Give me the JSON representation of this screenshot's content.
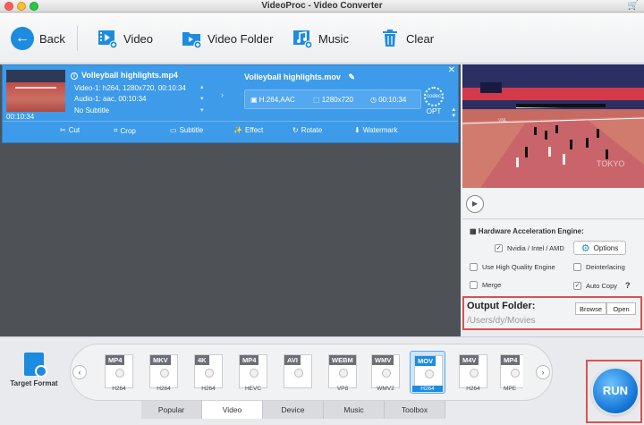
{
  "window": {
    "title": "VideoProc - Video Converter"
  },
  "toolbar": {
    "back": "Back",
    "video": "Video",
    "video_folder": "Video Folder",
    "music": "Music",
    "clear": "Clear"
  },
  "task": {
    "thumb_time": "00:10:34",
    "source_name": "Volleyball highlights.mp4",
    "video_track": "Video-1: h264, 1280x720, 00:10:34",
    "audio_track": "Audio-1: aac, 00:10:34",
    "subtitle": "No Subtitle",
    "output_name": "Volleyball highlights.mov",
    "codec": "H.264,AAC",
    "resolution": "1280x720",
    "duration": "00:10:34",
    "opt_label": "OPT",
    "codec_label": "codec",
    "edits": [
      "Cut",
      "Crop",
      "Subtitle",
      "Effect",
      "Rotate",
      "Watermark"
    ]
  },
  "hardware": {
    "title": "Hardware Acceleration Engine:",
    "nvidia": "Nvidia / Intel / AMD",
    "options": "Options",
    "high_quality": "Use High Quality Engine",
    "deinterlacing": "Deinterlacing",
    "merge": "Merge",
    "auto_copy": "Auto Copy",
    "help": "?"
  },
  "output": {
    "title": "Output Folder:",
    "path": "/Users/dy/Movies",
    "browse": "Browse",
    "open": "Open"
  },
  "target_format": "Target Format",
  "formats": [
    {
      "tag": "MP4",
      "sub": "H264"
    },
    {
      "tag": "MKV",
      "sub": "H264"
    },
    {
      "tag": "4K",
      "sub": "H264"
    },
    {
      "tag": "MP4",
      "sub": "HEVC"
    },
    {
      "tag": "AVI",
      "sub": ""
    },
    {
      "tag": "WEBM",
      "sub": "VP8"
    },
    {
      "tag": "WMV",
      "sub": "WMV2"
    },
    {
      "tag": "MOV",
      "sub": "H264"
    },
    {
      "tag": "M4V",
      "sub": "H264"
    },
    {
      "tag": "MP4",
      "sub": "MPE"
    }
  ],
  "tabs": [
    "Popular",
    "Video",
    "Device",
    "Music",
    "Toolbox"
  ],
  "run": "RUN",
  "colors": {
    "accent": "#1d8ce0",
    "task_bg": "#3d9be9",
    "highlight": "#d9534f"
  }
}
